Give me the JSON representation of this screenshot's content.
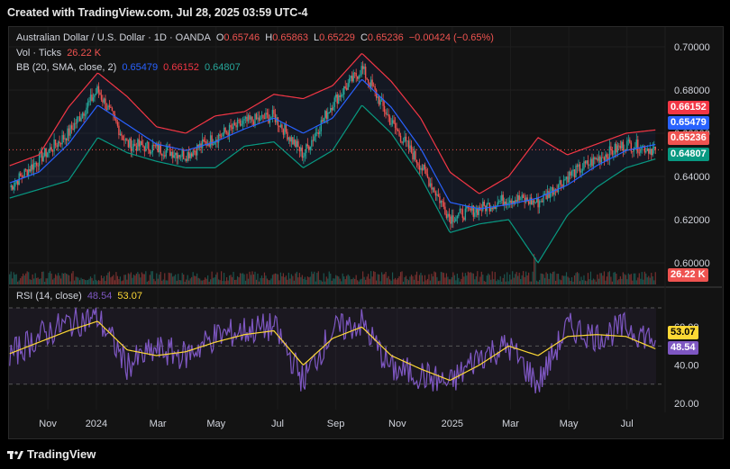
{
  "header": {
    "caption": "Created with TradingView.com, Jul 28, 2025 03:59 UTC-4"
  },
  "legend": {
    "symbol": "Australian Dollar / U.S. Dollar · 1D · OANDA",
    "o_label": "O",
    "o": "0.65746",
    "h_label": "H",
    "h": "0.65863",
    "l_label": "L",
    "l": "0.65229",
    "c_label": "C",
    "c": "0.65236",
    "change": "−0.00424 (−0.65%)",
    "vol_label": "Vol · Ticks",
    "vol": "26.22 K",
    "bb_label": "BB (20, SMA, close, 2)",
    "bb_basis": "0.65479",
    "bb_upper": "0.66152",
    "bb_lower": "0.64807",
    "rsi_label": "RSI (14, close)",
    "rsi_ma": "48.54",
    "rsi": "53.07"
  },
  "price_axis": {
    "ticks": [
      "0.70000",
      "0.68000",
      "0.66000",
      "0.64000",
      "0.62000",
      "0.60000"
    ]
  },
  "rsi_axis": {
    "ticks": [
      "60.00",
      "40.00",
      "20.00"
    ]
  },
  "time_axis": {
    "ticks": [
      "Nov",
      "2024",
      "Mar",
      "May",
      "Jul",
      "Sep",
      "Nov",
      "2025",
      "Mar",
      "May",
      "Jul"
    ]
  },
  "tags": {
    "upper": "0.66152",
    "basis": "0.65479",
    "close": "0.65236",
    "lower": "0.64807",
    "volume": "26.22 K",
    "rsi": "53.07",
    "rsi_ma": "48.54"
  },
  "colors": {
    "up": "#26a69a",
    "down": "#ef5350",
    "basis": "#2962ff",
    "upper": "#f23645",
    "lower": "#089981",
    "rsi": "#7e57c2",
    "rsi_ma": "#fdd835"
  },
  "footer": {
    "brand": "TradingView"
  },
  "chart_data": [
    {
      "type": "line",
      "title": "Australian Dollar / U.S. Dollar · 1D · OANDA",
      "x": [
        "2023-10-01",
        "2023-11-01",
        "2023-12-01",
        "2024-01-01",
        "2024-02-01",
        "2024-03-01",
        "2024-04-01",
        "2024-05-01",
        "2024-06-01",
        "2024-07-01",
        "2024-08-01",
        "2024-09-01",
        "2024-10-01",
        "2024-11-01",
        "2024-12-01",
        "2025-01-01",
        "2025-02-01",
        "2025-03-01",
        "2025-04-01",
        "2025-05-01",
        "2025-06-01",
        "2025-07-01",
        "2025-07-28"
      ],
      "series": [
        {
          "name": "close",
          "values": [
            0.635,
            0.648,
            0.66,
            0.68,
            0.655,
            0.653,
            0.65,
            0.658,
            0.665,
            0.668,
            0.65,
            0.674,
            0.69,
            0.665,
            0.645,
            0.621,
            0.625,
            0.63,
            0.628,
            0.64,
            0.648,
            0.655,
            0.65236
          ]
        },
        {
          "name": "basis",
          "values": [
            0.637,
            0.642,
            0.655,
            0.673,
            0.664,
            0.655,
            0.652,
            0.656,
            0.662,
            0.667,
            0.66,
            0.667,
            0.685,
            0.672,
            0.653,
            0.628,
            0.625,
            0.627,
            0.63,
            0.636,
            0.645,
            0.652,
            0.65479
          ]
        },
        {
          "name": "upper",
          "values": [
            0.645,
            0.65,
            0.672,
            0.688,
            0.677,
            0.663,
            0.66,
            0.668,
            0.67,
            0.678,
            0.676,
            0.682,
            0.697,
            0.684,
            0.667,
            0.642,
            0.632,
            0.64,
            0.658,
            0.65,
            0.655,
            0.66,
            0.66152
          ]
        },
        {
          "name": "lower",
          "values": [
            0.63,
            0.634,
            0.638,
            0.658,
            0.651,
            0.647,
            0.644,
            0.644,
            0.654,
            0.656,
            0.644,
            0.652,
            0.673,
            0.66,
            0.64,
            0.614,
            0.618,
            0.62,
            0.6,
            0.622,
            0.635,
            0.644,
            0.64807
          ]
        }
      ],
      "ylim": [
        0.59,
        0.705
      ],
      "grid": true
    },
    {
      "type": "line",
      "title": "RSI (14, close)",
      "x": [
        "2023-10-01",
        "2023-11-01",
        "2023-12-01",
        "2024-01-01",
        "2024-02-01",
        "2024-03-01",
        "2024-04-01",
        "2024-05-01",
        "2024-06-01",
        "2024-07-01",
        "2024-08-01",
        "2024-09-01",
        "2024-10-01",
        "2024-11-01",
        "2024-12-01",
        "2025-01-01",
        "2025-02-01",
        "2025-03-01",
        "2025-04-01",
        "2025-05-01",
        "2025-06-01",
        "2025-07-01",
        "2025-07-28"
      ],
      "series": [
        {
          "name": "RSI",
          "values": [
            45,
            55,
            62,
            65,
            40,
            48,
            45,
            55,
            58,
            60,
            32,
            58,
            62,
            38,
            35,
            30,
            45,
            50,
            30,
            60,
            55,
            60,
            53.07
          ]
        },
        {
          "name": "MA",
          "values": [
            46,
            52,
            58,
            63,
            48,
            45,
            47,
            52,
            56,
            58,
            40,
            54,
            60,
            45,
            38,
            32,
            40,
            50,
            45,
            55,
            56,
            55,
            48.54
          ]
        }
      ],
      "ylim": [
        20,
        70
      ]
    }
  ]
}
